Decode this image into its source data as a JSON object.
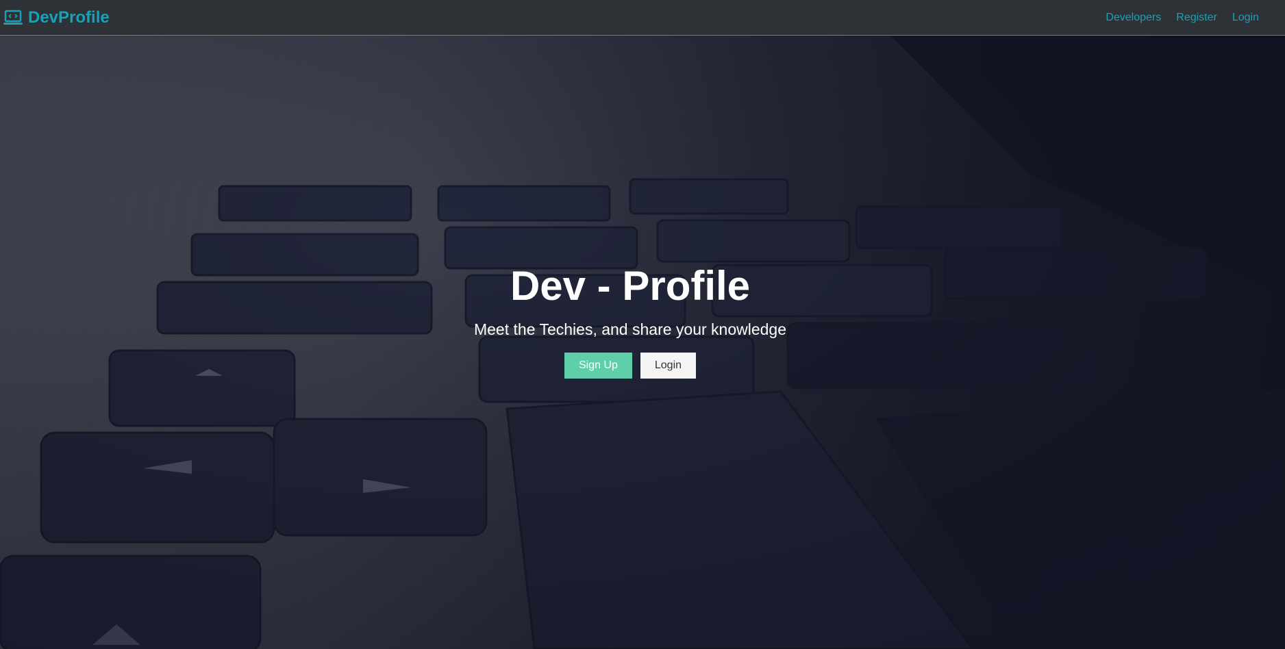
{
  "navbar": {
    "brand": "DevProfile",
    "brand_icon": "laptop-code-icon",
    "links": [
      "Developers",
      "Register",
      "Login"
    ]
  },
  "hero": {
    "title": "Dev - Profile",
    "subtitle": "Meet the Techies, and share your knowledge",
    "signup_label": "Sign Up",
    "login_label": "Login"
  },
  "colors": {
    "accent": "#17a2b8",
    "navbar_bg": "#2e3136",
    "signup_button": "#5ecfa8"
  }
}
